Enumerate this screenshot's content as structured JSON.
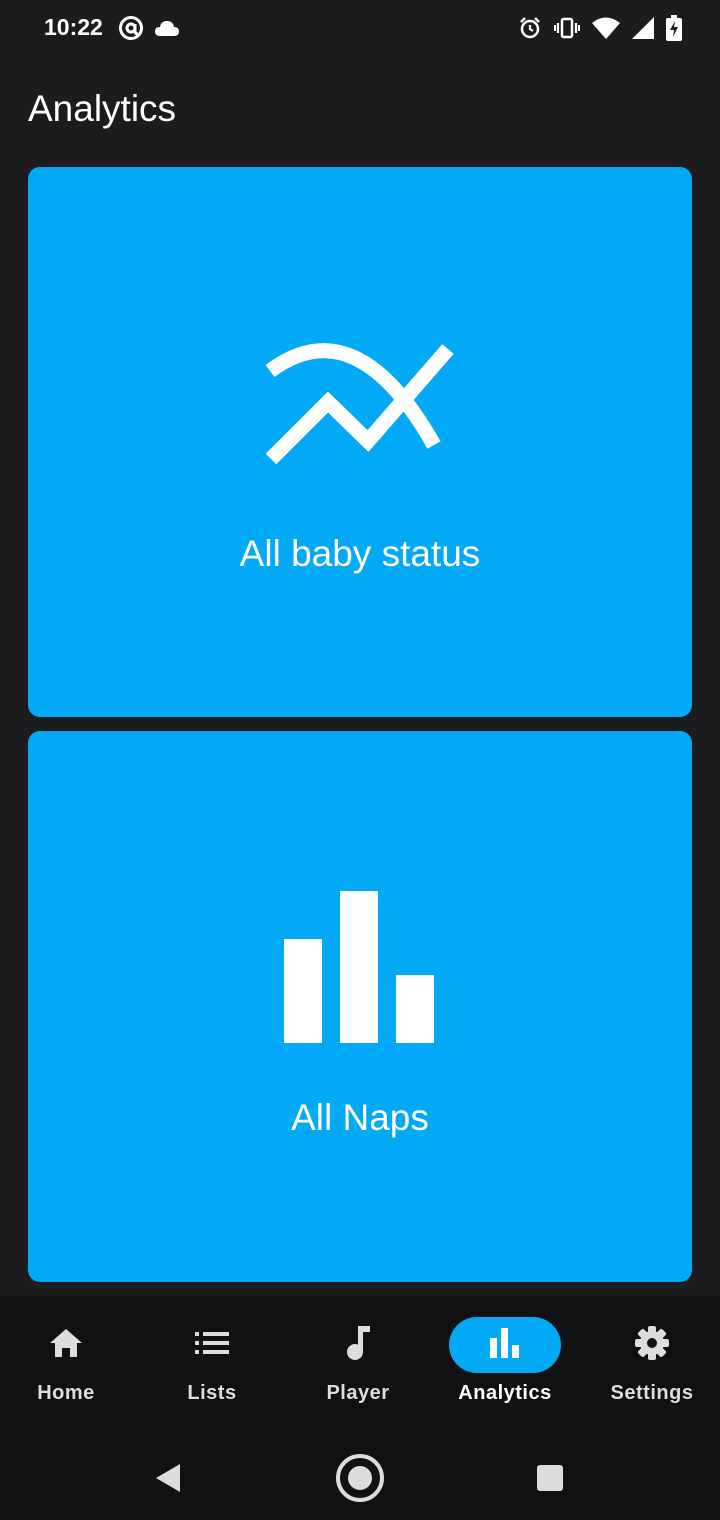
{
  "status_bar": {
    "time": "10:22",
    "left_icons": [
      "at-sign-icon",
      "cloud-icon"
    ],
    "right_icons": [
      "alarm-icon",
      "vibrate-icon",
      "wifi-icon",
      "signal-icon",
      "battery-charging-icon"
    ]
  },
  "header": {
    "title": "Analytics"
  },
  "cards": [
    {
      "label": "All baby status",
      "icon": "trending-chart-icon"
    },
    {
      "label": "All Naps",
      "icon": "bar-chart-icon"
    }
  ],
  "bottom_nav": {
    "items": [
      {
        "label": "Home",
        "icon": "home-icon",
        "active": false
      },
      {
        "label": "Lists",
        "icon": "list-icon",
        "active": false
      },
      {
        "label": "Player",
        "icon": "music-note-icon",
        "active": false
      },
      {
        "label": "Analytics",
        "icon": "analytics-icon",
        "active": true
      },
      {
        "label": "Settings",
        "icon": "gear-icon",
        "active": false
      }
    ]
  },
  "system_nav": {
    "buttons": [
      "back-icon",
      "home-circle-icon",
      "recents-icon"
    ]
  },
  "colors": {
    "accent": "#02aaf6",
    "background": "#1c1c1e",
    "nav_background": "#111113"
  }
}
